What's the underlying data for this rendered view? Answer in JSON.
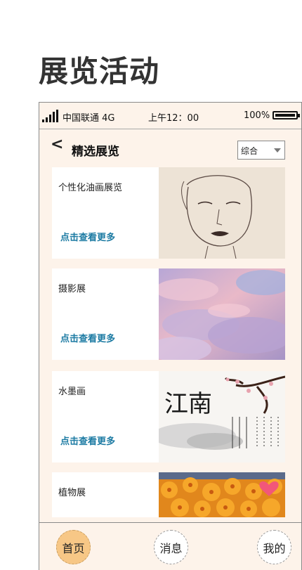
{
  "page_heading": "展览活动",
  "status_bar": {
    "carrier": "中国联通 4G",
    "time": "上午12：00",
    "battery": "100%"
  },
  "nav": {
    "back": "<",
    "title": "精选展览",
    "sort_value": "综合"
  },
  "cards": [
    {
      "title": "个性化油画展览",
      "more": "点击查看更多",
      "image": "portrait-sketch"
    },
    {
      "title": "摄影展",
      "more": "点击查看更多",
      "image": "pink-clouds"
    },
    {
      "title": "水墨画",
      "more": "点击查看更多",
      "image": "ink-painting-jiangnan"
    },
    {
      "title": "植物展",
      "more": "",
      "image": "orange-flowers"
    }
  ],
  "ink_painting_text": "江南",
  "tabs": [
    {
      "label": "首页",
      "active": true
    },
    {
      "label": "消息",
      "active": false
    },
    {
      "label": "我的",
      "active": false
    }
  ],
  "colors": {
    "accent_link": "#1d7ba3",
    "phone_bg": "#fdf3ea",
    "active_tab": "#f7c786"
  }
}
